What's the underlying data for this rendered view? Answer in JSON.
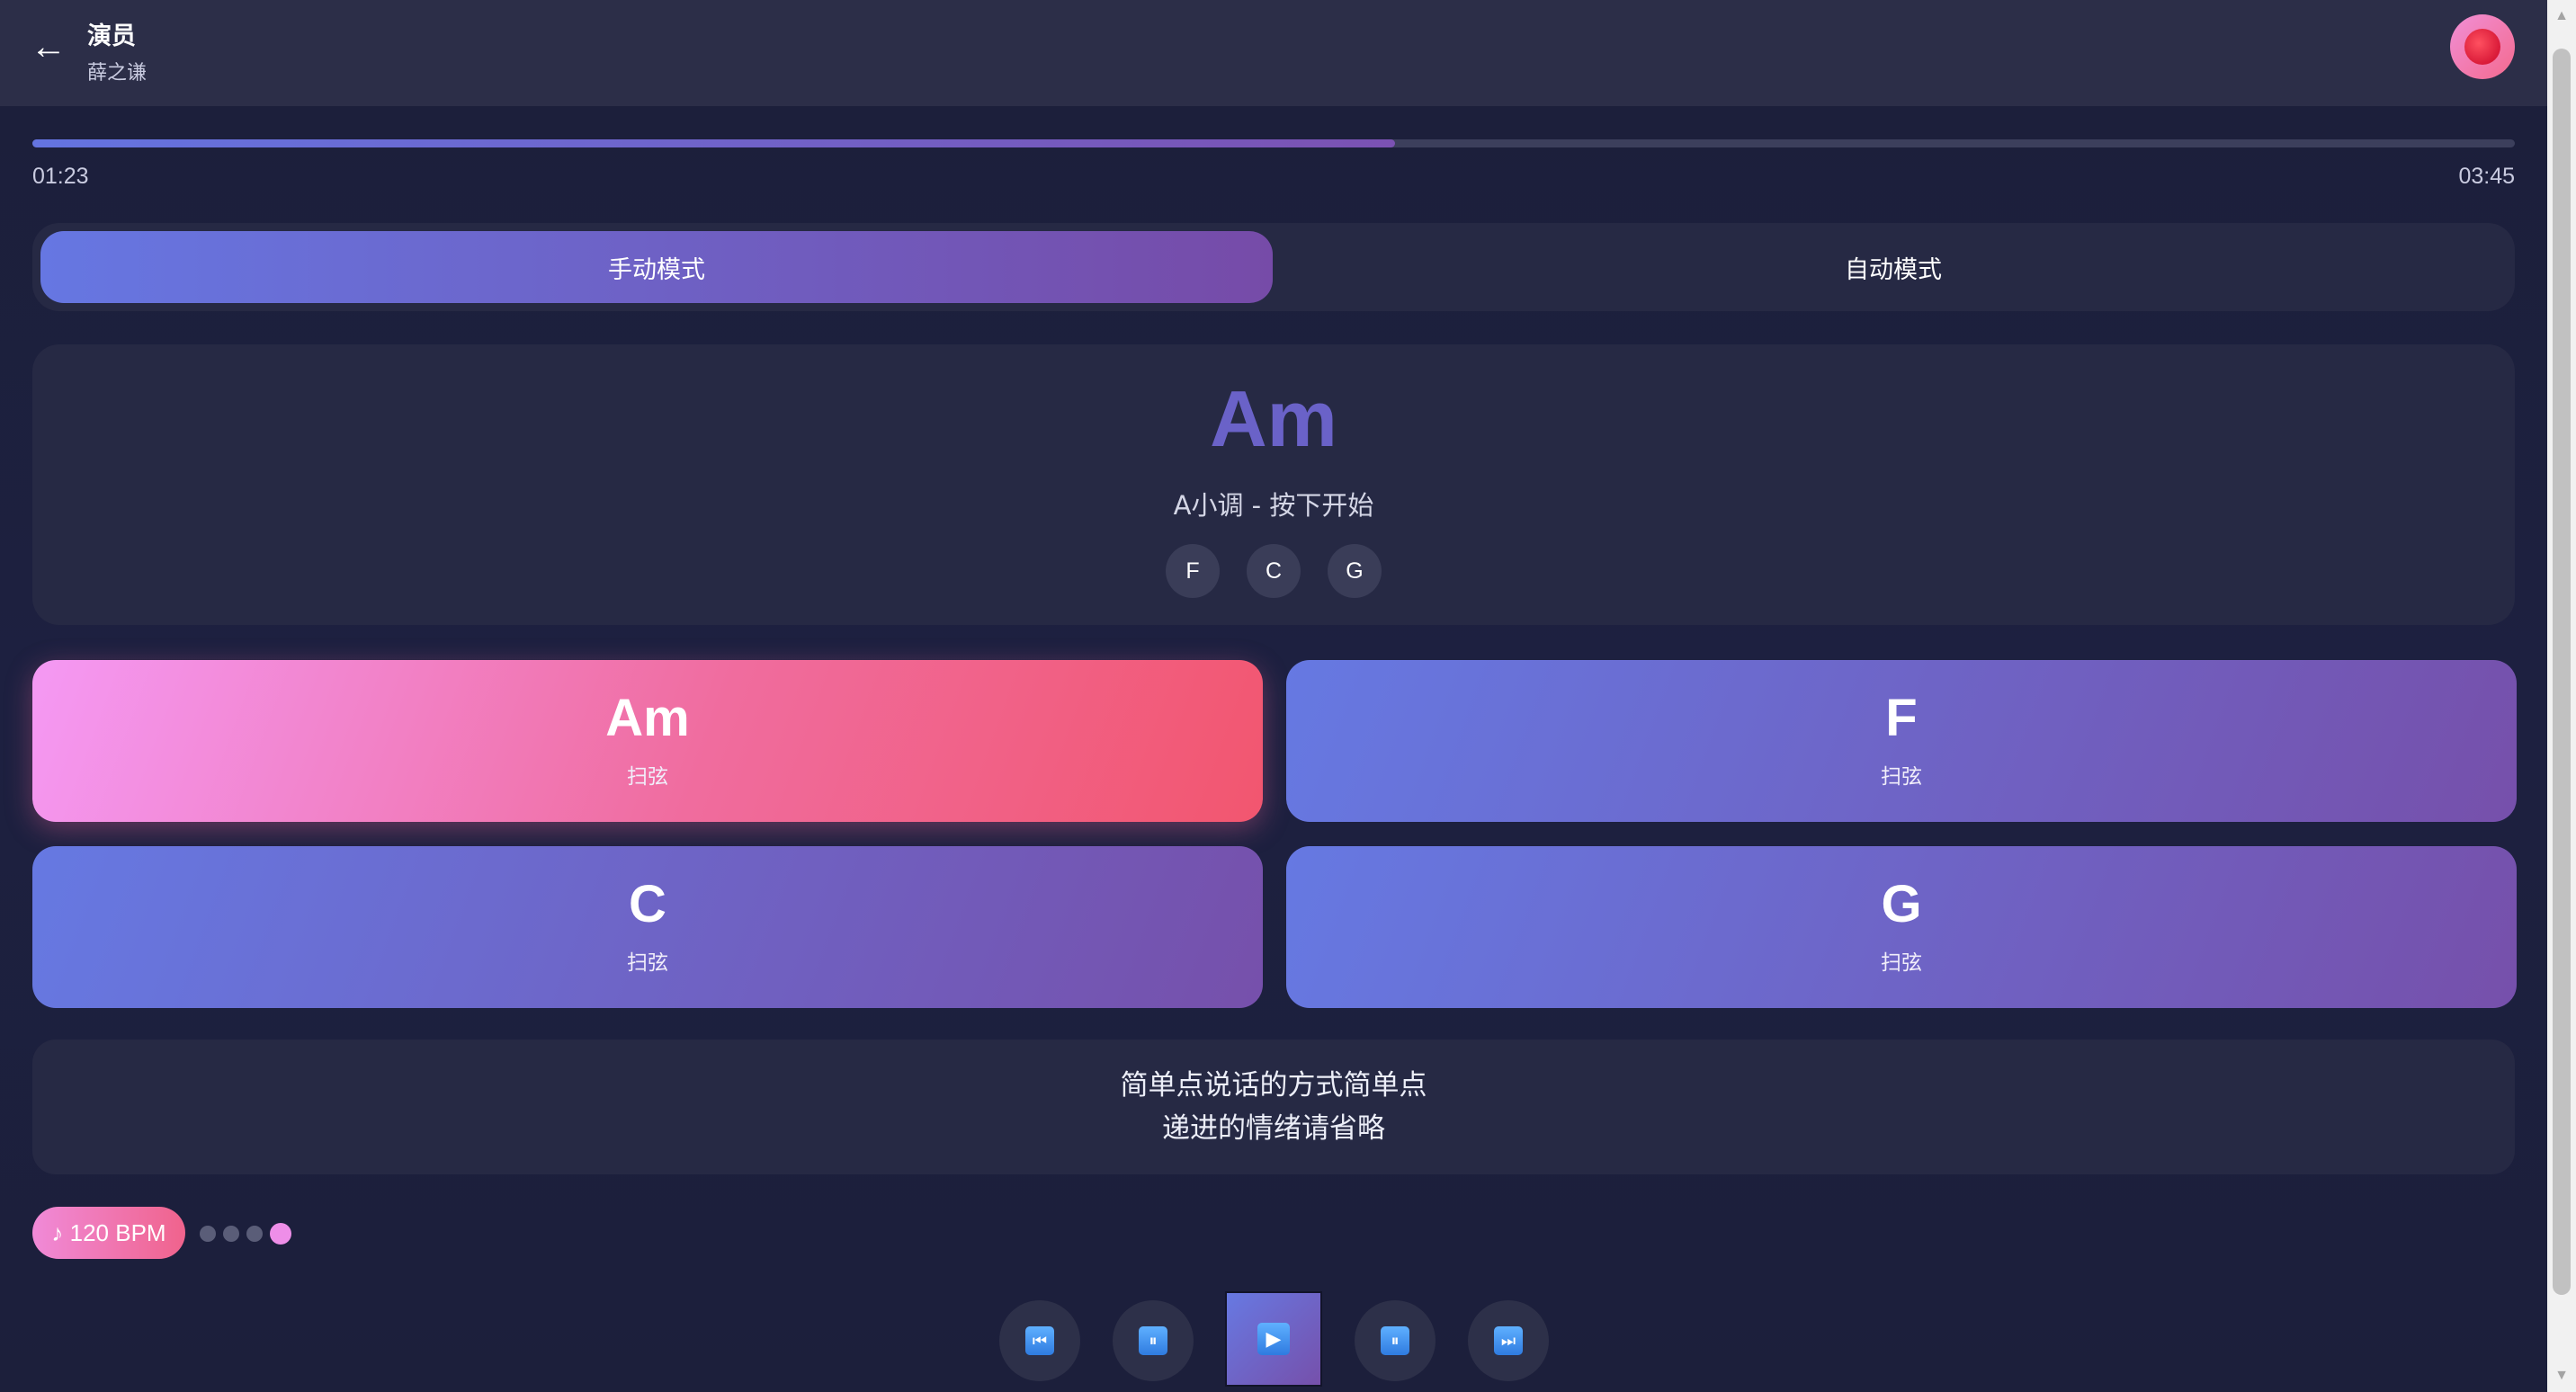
{
  "header": {
    "back_icon": "back-arrow-icon",
    "back_glyph": "←",
    "title": "演员",
    "artist": "薛之谦",
    "record_icon": "record-icon"
  },
  "progress": {
    "current": "01:23",
    "total": "03:45",
    "fraction": 0.549
  },
  "modes": [
    {
      "label": "手动模式",
      "active": true
    },
    {
      "label": "自动模式",
      "active": false
    }
  ],
  "chord_display": {
    "current": "Am",
    "description": "A小调 - 按下开始",
    "next": [
      "F",
      "C",
      "G"
    ]
  },
  "pads": [
    {
      "chord": "Am",
      "label": "扫弦",
      "active": true
    },
    {
      "chord": "F",
      "label": "扫弦",
      "active": false
    },
    {
      "chord": "C",
      "label": "扫弦",
      "active": false
    },
    {
      "chord": "G",
      "label": "扫弦",
      "active": false
    }
  ],
  "lyrics": {
    "line1": "简单点说话的方式简单点",
    "line2": "递进的情绪请省略"
  },
  "tempo": {
    "bpm_label": "♪ 120 BPM",
    "beats_total": 4,
    "beat_active": 4
  },
  "controls": {
    "rewind_icon": "rewind-icon",
    "rewind_glyph": "⏮",
    "pause_left_icon": "pause-icon",
    "pause_glyph": "⏸",
    "play_icon": "play-icon",
    "play_glyph": "▶",
    "pause_right_icon": "pause-icon",
    "forward_icon": "fast-forward-icon",
    "forward_glyph": "⏭"
  },
  "colors": {
    "accent_start": "#6677e2",
    "accent_end": "#764ba8",
    "active_pad_start": "#f499f4",
    "active_pad_end": "#f2566f",
    "current_chord": "#6a62c8"
  }
}
